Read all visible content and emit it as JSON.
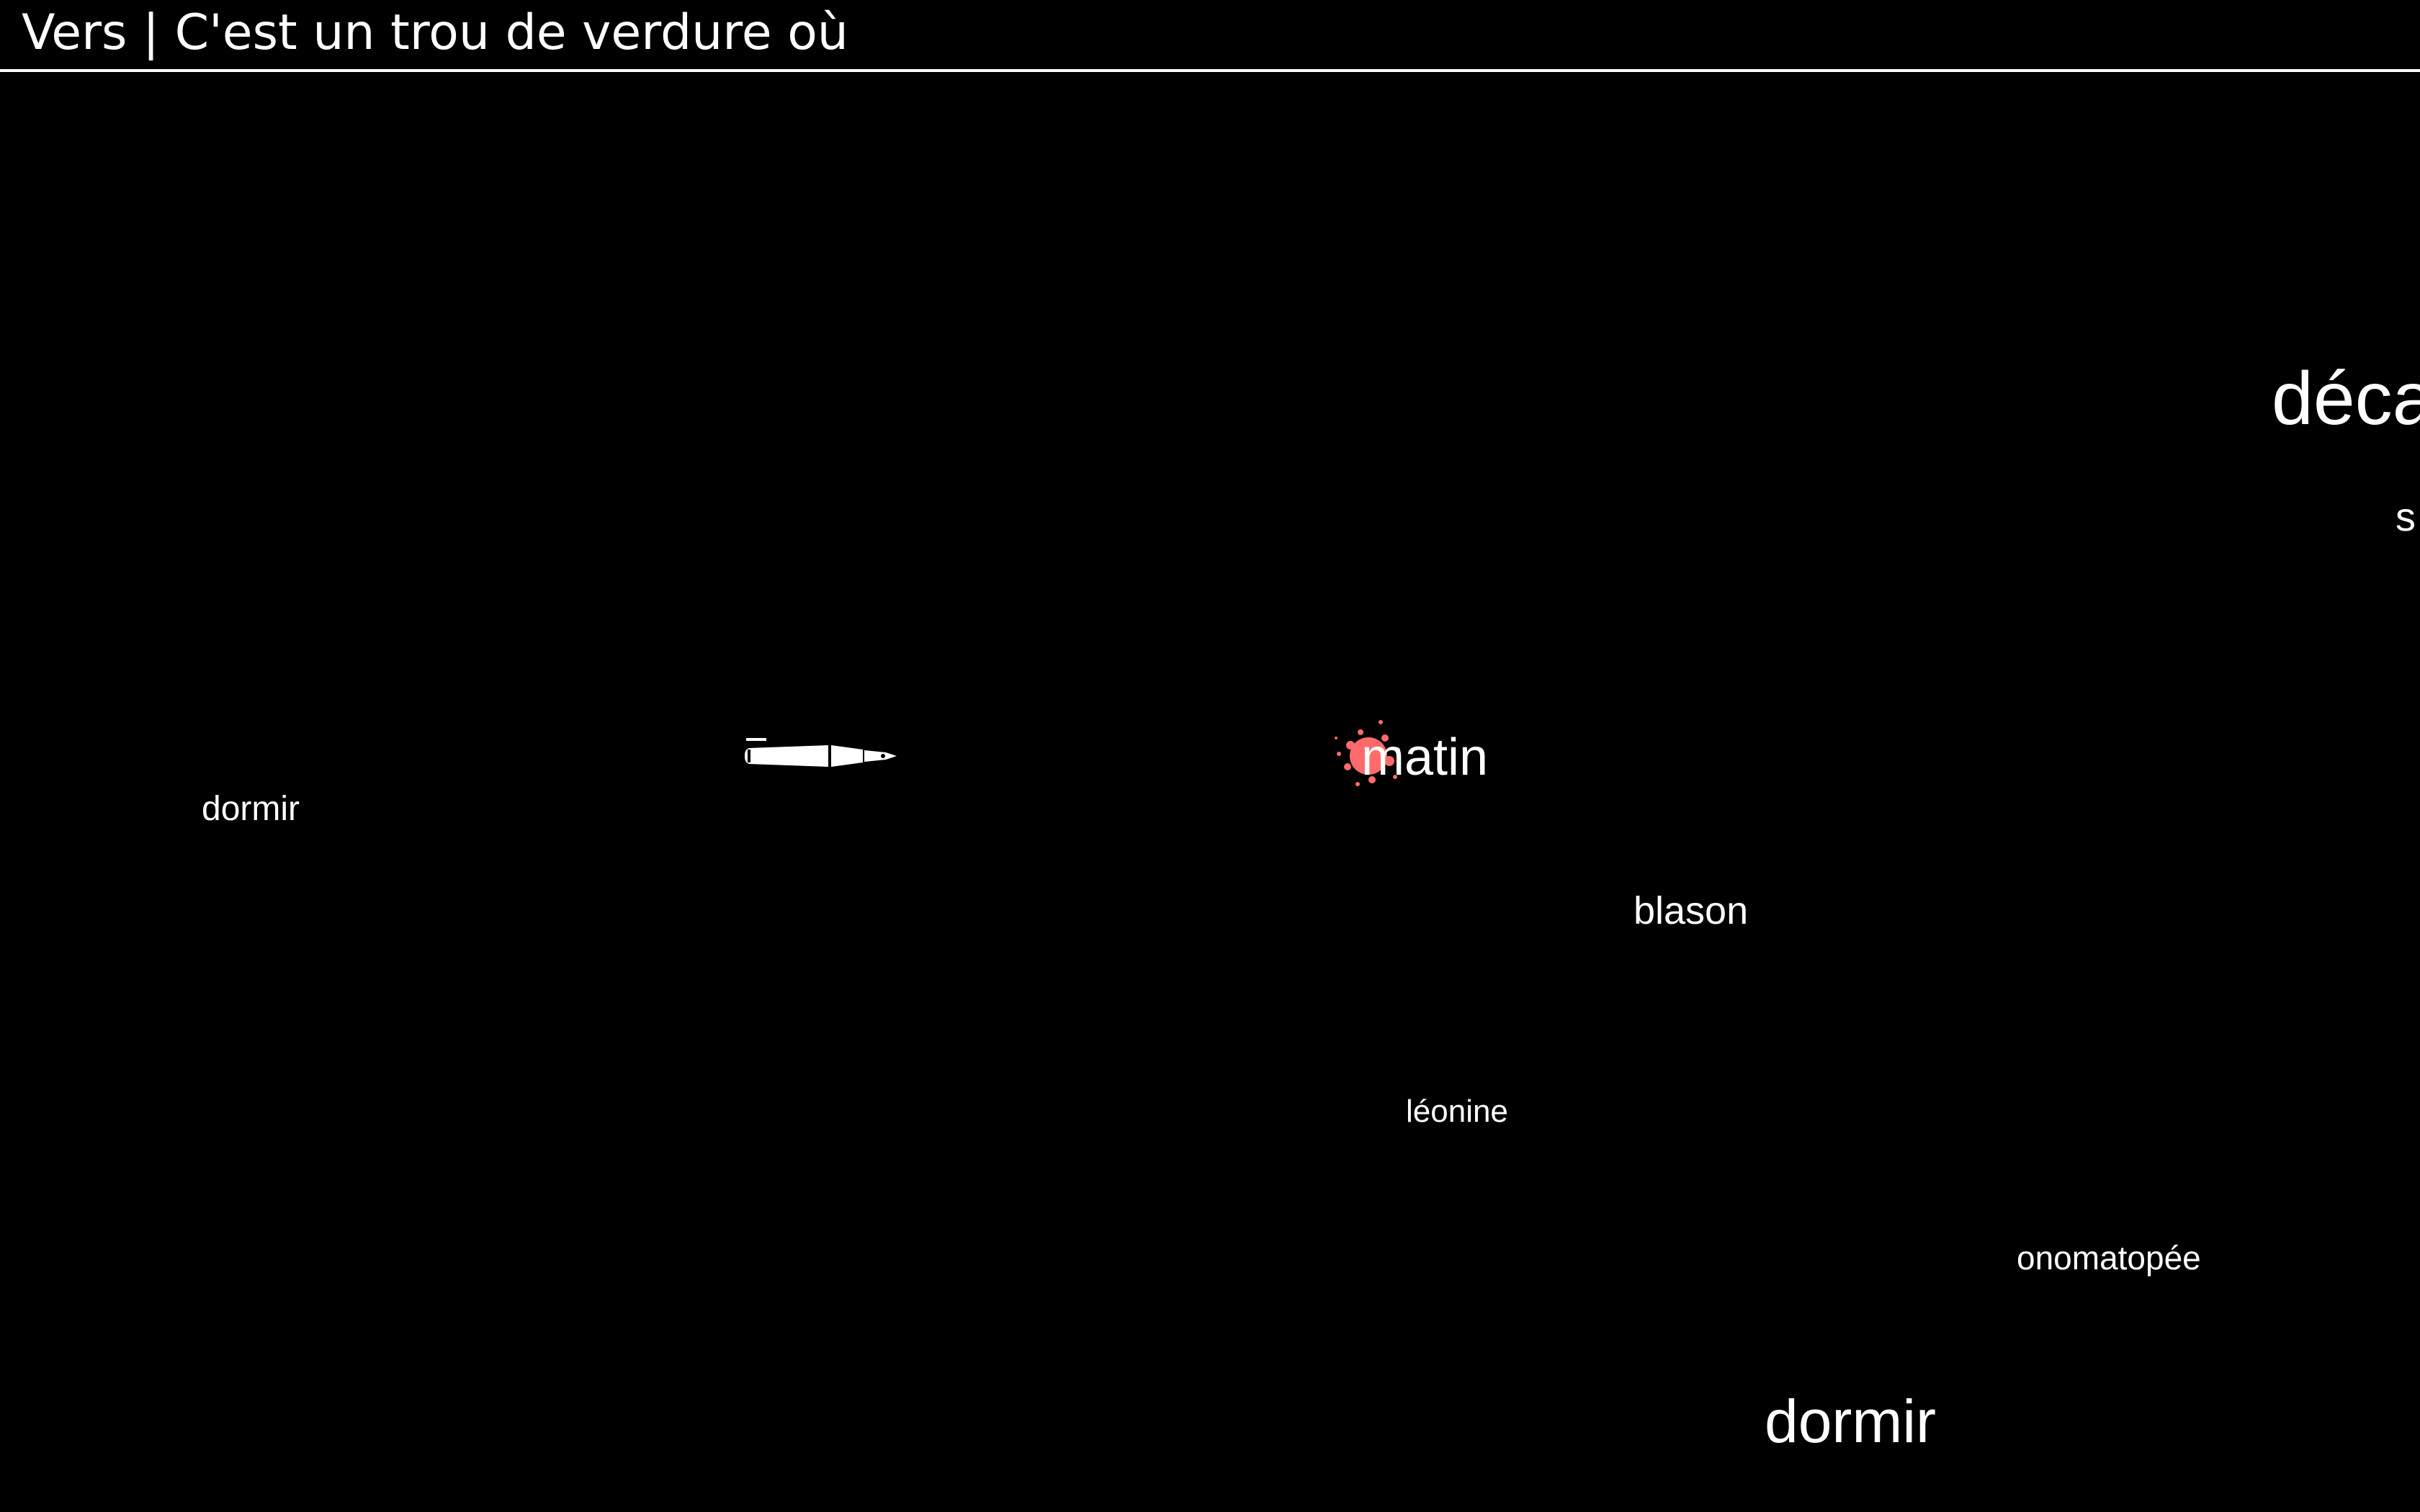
{
  "header": {
    "title": "Vers | C'est un trou de verdure où"
  },
  "words": {
    "dormir_left": "dormir",
    "matin": "matin",
    "blason": "blason",
    "leonine": "léonine",
    "onomatopee": "onomatopée",
    "dormir_bottom": "dormir",
    "deca": "déca",
    "s": "s"
  },
  "sprites": {
    "player": "fountain-pen-icon",
    "ink_splash": "ink-splash-icon"
  },
  "colors": {
    "background": "#000000",
    "text": "#ffffff",
    "ink_splash": "#ff6b6b"
  }
}
